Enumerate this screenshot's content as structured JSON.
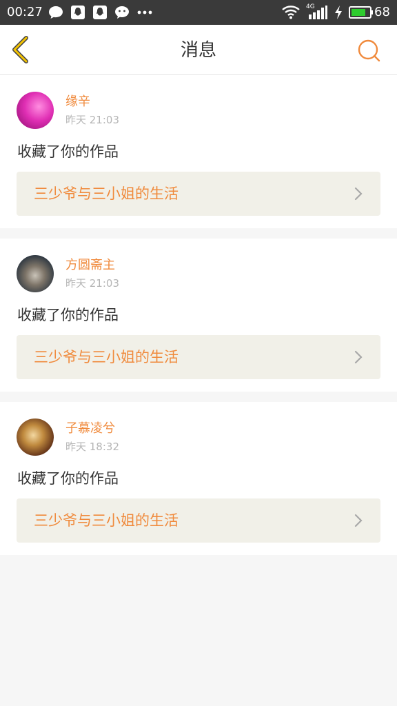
{
  "status_bar": {
    "time": "00:27",
    "network": "4G",
    "battery": "68",
    "icons": [
      "chat-bubble-icon",
      "qq-icon",
      "qq-icon",
      "wechat-icon",
      "more-dots-icon",
      "wifi-icon",
      "signal-icon",
      "charging-icon",
      "battery-icon"
    ]
  },
  "header": {
    "title": "消息",
    "back_icon": "chevron-left-icon",
    "search_icon": "search-icon"
  },
  "colors": {
    "accent": "#f08a3c",
    "back_arrow": "#f5c400",
    "card_link_bg": "#f1f0e8",
    "page_bg": "#f6f6f6"
  },
  "messages": [
    {
      "username": "缘辛",
      "time": "昨天 21:03",
      "action": "收藏了你的作品",
      "work_title": "三少爷与三小姐的生活"
    },
    {
      "username": "方圆斋主",
      "time": "昨天 21:03",
      "action": "收藏了你的作品",
      "work_title": "三少爷与三小姐的生活"
    },
    {
      "username": "子慕凌兮",
      "time": "昨天 18:32",
      "action": "收藏了你的作品",
      "work_title": "三少爷与三小姐的生活"
    }
  ]
}
